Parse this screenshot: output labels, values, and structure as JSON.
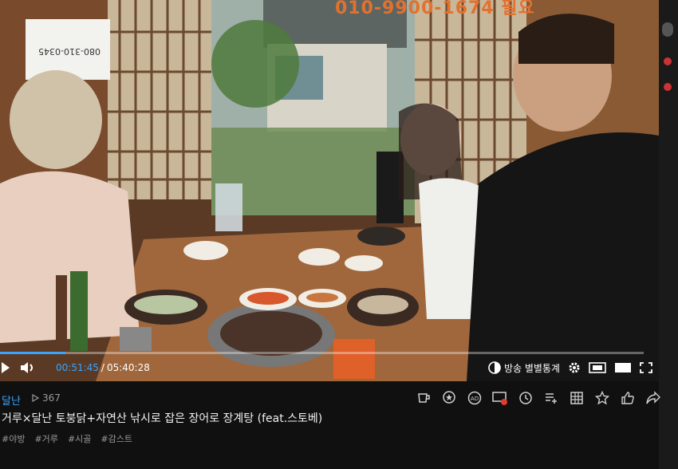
{
  "video": {
    "sign_text": "080-310-0345",
    "overlay_text": "010-9900-1674 필요"
  },
  "player": {
    "progress_fraction": 0.1022,
    "time_current": "00:51:45",
    "time_separator": "/",
    "time_total": "05:40:28",
    "stats_label": "방송 별별통계"
  },
  "info": {
    "streamer": "달난",
    "views": "367",
    "title": "거루×달난 토붕닭+자연산 낚시로 잡은 장어로 장계탕 (feat.스토베)",
    "tags": [
      "#야방",
      "#거루",
      "#시골",
      "#감스트"
    ]
  },
  "icons": {
    "play": "play-icon",
    "volume": "volume-icon",
    "settings": "gear-icon",
    "theater": "theater-icon",
    "fullscreen": "fullscreen-icon",
    "views": "play-count-icon",
    "actions": [
      "cup-icon",
      "star-badge-icon",
      "ad-icon",
      "chat-icon",
      "history-icon",
      "playlist-add-icon",
      "grid-icon",
      "favorite-icon",
      "like-icon",
      "share-icon"
    ]
  },
  "colors": {
    "accent": "#3aa4ff",
    "overlay": "#e3712e"
  }
}
